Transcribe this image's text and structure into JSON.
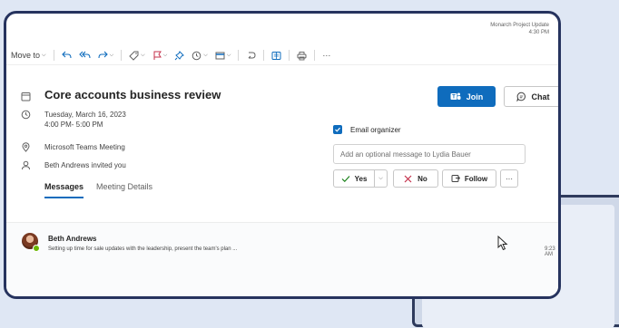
{
  "top_info": {
    "title": "Monarch Project Update",
    "time": "4:30 PM"
  },
  "toolbar": {
    "move_to_label": "Move to",
    "more_label": "···"
  },
  "event": {
    "subject": "Core accounts business review",
    "date": "Tuesday, March 16, 2023",
    "time": "4:00 PM- 5:00 PM",
    "location": "Microsoft Teams Meeting",
    "invited_by": "Beth Andrews invited you"
  },
  "tabs": [
    {
      "label": "Messages",
      "active": true
    },
    {
      "label": "Meeting Details",
      "active": false
    }
  ],
  "actions": {
    "join_label": "Join",
    "chat_label": "Chat"
  },
  "email_organizer": {
    "label": "Email organizer",
    "checked": true
  },
  "message_field": {
    "placeholder": "Add an optional message to Lydia Bauer",
    "value": ""
  },
  "rsvp": {
    "yes_label": "Yes",
    "no_label": "No",
    "follow_label": "Follow",
    "more_label": "···"
  },
  "message_item": {
    "sender": "Beth Andrews",
    "preview": "Setting up time for sale updates with the leadership, present the team's plan ...",
    "time": "9:23 AM"
  },
  "colors": {
    "accent": "#0f6cbd",
    "window_border": "#26335e",
    "presence": "#6bb700"
  }
}
